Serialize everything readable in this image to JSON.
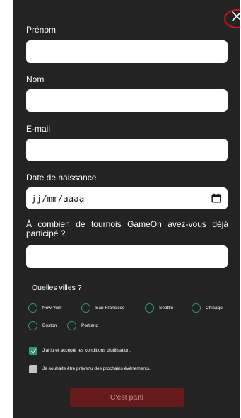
{
  "modal": {
    "close_icon": "close-icon",
    "close_highlight_color": "#d40f1e"
  },
  "form": {
    "first_name": {
      "label": "Prénom",
      "value": ""
    },
    "last_name": {
      "label": "Nom",
      "value": ""
    },
    "email": {
      "label": "E-mail",
      "value": ""
    },
    "birthdate": {
      "label": "Date de naissance",
      "value": "jj/mm/aaaa",
      "icon": "calendar-icon"
    },
    "tournaments": {
      "label": "À combien de tournois GameOn avez-vous déjà participé ?",
      "value": ""
    },
    "cities": {
      "title": "Quelles villes ?",
      "options": [
        {
          "label": "New York",
          "selected": false
        },
        {
          "label": "San Francisco",
          "selected": false
        },
        {
          "label": "Seattle",
          "selected": false
        },
        {
          "label": "Chicago",
          "selected": false
        },
        {
          "label": "Boston",
          "selected": false
        },
        {
          "label": "Portland",
          "selected": false
        }
      ]
    },
    "terms": {
      "label": "J'ai lu et accepté les conditions d'utilisation.",
      "checked": true
    },
    "newsletter": {
      "label": "Je souhaite être prévenu des prochains évènements.",
      "checked": false
    },
    "submit_label": "C'est parti"
  },
  "colors": {
    "background": "#232323",
    "accent_green": "#279e7a",
    "button_bg": "#661a1a",
    "button_text": "#c98e8e"
  }
}
